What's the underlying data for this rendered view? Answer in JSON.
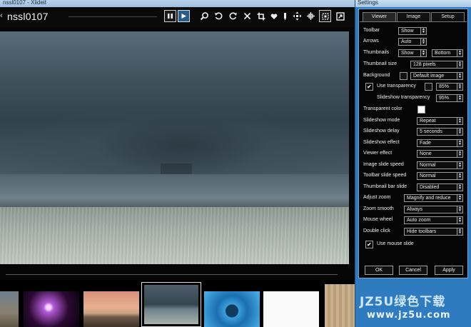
{
  "viewer": {
    "window_title": "nssl0107 - Xlideit",
    "image_name": "nssl0107",
    "toolbar_icons": [
      "pause-icon",
      "play-icon",
      "zoom-icon",
      "rotate-left-icon",
      "rotate-right-icon",
      "close-icon",
      "crop-icon",
      "heart-icon",
      "dropper-icon",
      "move-icon",
      "fit-icon",
      "fullscreen-icon"
    ]
  },
  "settings": {
    "window_title": "Settings",
    "tabs": [
      {
        "label": "Viewer"
      },
      {
        "label": "Image"
      },
      {
        "label": "Setup"
      }
    ],
    "rows": {
      "toolbar": {
        "label": "Toolbar",
        "value": "Show"
      },
      "arrows": {
        "label": "Arrows",
        "value": "Auto"
      },
      "thumbnails": {
        "label": "Thumbnails",
        "value": "Show",
        "position": "Bottom"
      },
      "thumbnail_size": {
        "label": "Thumbnail size",
        "value": "128 pixels"
      },
      "background": {
        "label": "Background",
        "value": "Default image",
        "color": "#111111"
      },
      "use_transparency": {
        "label": "Use transparency",
        "value": "85%",
        "checked": "✔"
      },
      "slideshow_transparency": {
        "label": "Slideshow transparency",
        "value": "95%"
      },
      "transparent_color": {
        "label": "Transparent color",
        "color": "#ffffff"
      },
      "slideshow_mode": {
        "label": "Slideshow mode",
        "value": "Repeat"
      },
      "slideshow_delay": {
        "label": "Slideshow delay",
        "value": "5 seconds"
      },
      "slideshow_effect": {
        "label": "Slideshow effect",
        "value": "Fade"
      },
      "viewer_effect": {
        "label": "Viewer effect",
        "value": "None"
      },
      "image_slide_speed": {
        "label": "Image slide speed",
        "value": "Normal"
      },
      "toolbar_slide_speed": {
        "label": "Toolbar slide speed",
        "value": "Normal"
      },
      "thumbnail_bar_slide": {
        "label": "Thumbnail bar slide",
        "value": "Disabled"
      },
      "adjust_zoom": {
        "label": "Adjust zoom",
        "value": "Magnify and reduce"
      },
      "zoom_smooth": {
        "label": "Zoom smooth",
        "value": "Always"
      },
      "mouse_wheel": {
        "label": "Mouse wheel",
        "value": "Auto zoom"
      },
      "double_click": {
        "label": "Double click",
        "value": "Hide toolbars"
      },
      "use_mouse_slide": {
        "label": "Use mouse slide",
        "checked": "✔"
      }
    },
    "buttons": {
      "ok": "OK",
      "cancel": "Cancel",
      "apply": "Apply"
    }
  },
  "watermark": {
    "line1": "JZ5U绿色下载",
    "line2": "www.jz5u.com"
  }
}
